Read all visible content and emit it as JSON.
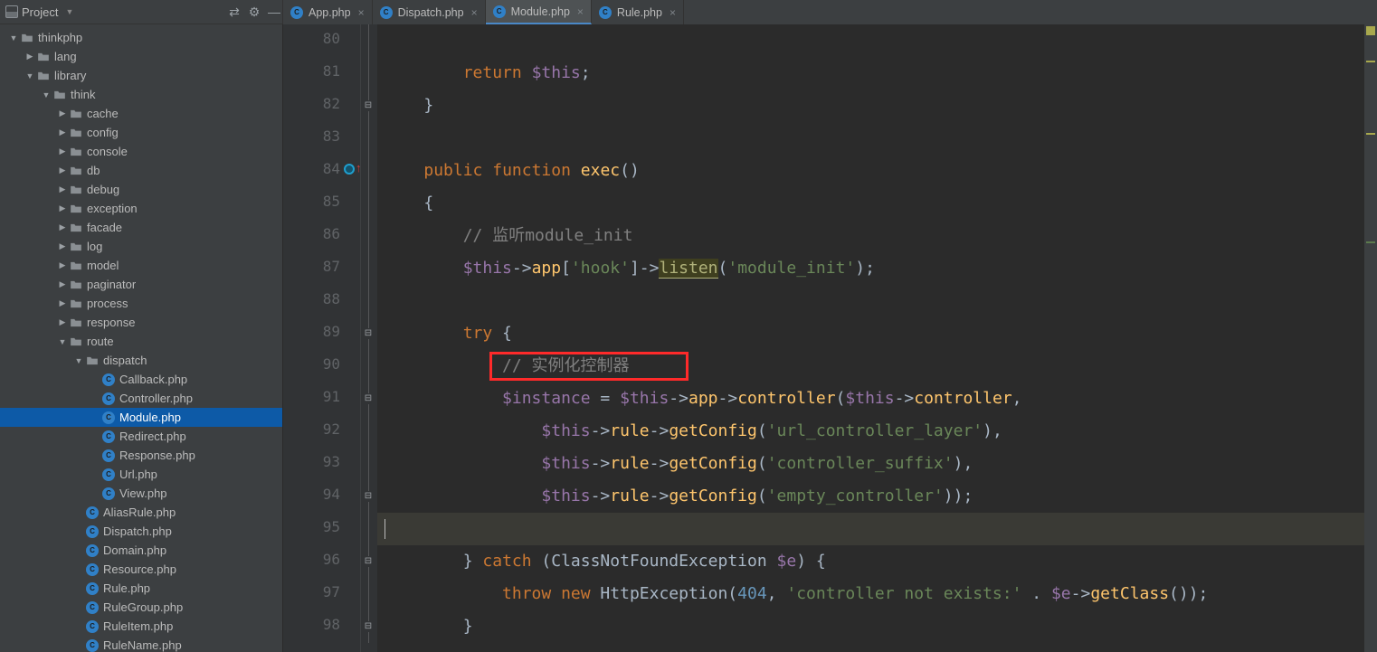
{
  "topbar": {
    "project_label": "Project",
    "settings_icon": "gear-icon",
    "hide_icon": "collapse-icon"
  },
  "tabs": [
    {
      "label": "App.php",
      "active": false
    },
    {
      "label": "Dispatch.php",
      "active": false
    },
    {
      "label": "Module.php",
      "active": true
    },
    {
      "label": "Rule.php",
      "active": false
    }
  ],
  "tree": [
    {
      "depth": 0,
      "arrow": "down",
      "kind": "folder",
      "label": "thinkphp"
    },
    {
      "depth": 1,
      "arrow": "right",
      "kind": "folder",
      "label": "lang"
    },
    {
      "depth": 1,
      "arrow": "down",
      "kind": "folder",
      "label": "library"
    },
    {
      "depth": 2,
      "arrow": "down",
      "kind": "folder",
      "label": "think"
    },
    {
      "depth": 3,
      "arrow": "right",
      "kind": "folder",
      "label": "cache"
    },
    {
      "depth": 3,
      "arrow": "right",
      "kind": "folder",
      "label": "config"
    },
    {
      "depth": 3,
      "arrow": "right",
      "kind": "folder",
      "label": "console"
    },
    {
      "depth": 3,
      "arrow": "right",
      "kind": "folder",
      "label": "db"
    },
    {
      "depth": 3,
      "arrow": "right",
      "kind": "folder",
      "label": "debug"
    },
    {
      "depth": 3,
      "arrow": "right",
      "kind": "folder",
      "label": "exception"
    },
    {
      "depth": 3,
      "arrow": "right",
      "kind": "folder",
      "label": "facade"
    },
    {
      "depth": 3,
      "arrow": "right",
      "kind": "folder",
      "label": "log"
    },
    {
      "depth": 3,
      "arrow": "right",
      "kind": "folder",
      "label": "model"
    },
    {
      "depth": 3,
      "arrow": "right",
      "kind": "folder",
      "label": "paginator"
    },
    {
      "depth": 3,
      "arrow": "right",
      "kind": "folder",
      "label": "process"
    },
    {
      "depth": 3,
      "arrow": "right",
      "kind": "folder",
      "label": "response"
    },
    {
      "depth": 3,
      "arrow": "down",
      "kind": "folder",
      "label": "route"
    },
    {
      "depth": 4,
      "arrow": "down",
      "kind": "folder",
      "label": "dispatch"
    },
    {
      "depth": 5,
      "arrow": "",
      "kind": "php",
      "label": "Callback.php"
    },
    {
      "depth": 5,
      "arrow": "",
      "kind": "php",
      "label": "Controller.php"
    },
    {
      "depth": 5,
      "arrow": "",
      "kind": "php",
      "label": "Module.php",
      "selected": true
    },
    {
      "depth": 5,
      "arrow": "",
      "kind": "php",
      "label": "Redirect.php"
    },
    {
      "depth": 5,
      "arrow": "",
      "kind": "php",
      "label": "Response.php"
    },
    {
      "depth": 5,
      "arrow": "",
      "kind": "php",
      "label": "Url.php"
    },
    {
      "depth": 5,
      "arrow": "",
      "kind": "php",
      "label": "View.php"
    },
    {
      "depth": 4,
      "arrow": "",
      "kind": "php",
      "label": "AliasRule.php"
    },
    {
      "depth": 4,
      "arrow": "",
      "kind": "php",
      "label": "Dispatch.php"
    },
    {
      "depth": 4,
      "arrow": "",
      "kind": "php",
      "label": "Domain.php"
    },
    {
      "depth": 4,
      "arrow": "",
      "kind": "php",
      "label": "Resource.php"
    },
    {
      "depth": 4,
      "arrow": "",
      "kind": "php",
      "label": "Rule.php"
    },
    {
      "depth": 4,
      "arrow": "",
      "kind": "php",
      "label": "RuleGroup.php"
    },
    {
      "depth": 4,
      "arrow": "",
      "kind": "php",
      "label": "RuleItem.php"
    },
    {
      "depth": 4,
      "arrow": "",
      "kind": "php",
      "label": "RuleName.php"
    }
  ],
  "editor": {
    "line_start": 80,
    "line_height": 36,
    "current_line": 95,
    "override_marker_line": 84,
    "fold_minus_lines": [
      82,
      89,
      91,
      94,
      96,
      98
    ],
    "lines": [
      {
        "n": 80,
        "tokens": []
      },
      {
        "n": 81,
        "tokens": [
          {
            "t": "pad",
            "v": "        "
          },
          {
            "t": "kw",
            "v": "return"
          },
          {
            "t": "punct",
            "v": " "
          },
          {
            "t": "var",
            "v": "$this"
          },
          {
            "t": "punct",
            "v": ";"
          }
        ]
      },
      {
        "n": 82,
        "tokens": [
          {
            "t": "pad",
            "v": "    "
          },
          {
            "t": "punct",
            "v": "}"
          }
        ]
      },
      {
        "n": 83,
        "tokens": []
      },
      {
        "n": 84,
        "tokens": [
          {
            "t": "pad",
            "v": "    "
          },
          {
            "t": "kw",
            "v": "public"
          },
          {
            "t": "punct",
            "v": " "
          },
          {
            "t": "kw",
            "v": "function"
          },
          {
            "t": "punct",
            "v": " "
          },
          {
            "t": "fnDef",
            "v": "exec"
          },
          {
            "t": "punct",
            "v": "()"
          }
        ]
      },
      {
        "n": 85,
        "tokens": [
          {
            "t": "pad",
            "v": "    "
          },
          {
            "t": "punct",
            "v": "{"
          }
        ]
      },
      {
        "n": 86,
        "tokens": [
          {
            "t": "pad",
            "v": "        "
          },
          {
            "t": "cmt",
            "v": "// 监听module_init"
          }
        ]
      },
      {
        "n": 87,
        "tokens": [
          {
            "t": "pad",
            "v": "        "
          },
          {
            "t": "var",
            "v": "$this"
          },
          {
            "t": "punct",
            "v": "->"
          },
          {
            "t": "fn",
            "v": "app"
          },
          {
            "t": "punct",
            "v": "["
          },
          {
            "t": "str",
            "v": "'hook'"
          },
          {
            "t": "punct",
            "v": "]->"
          },
          {
            "t": "hl",
            "v": "listen"
          },
          {
            "t": "punct",
            "v": "("
          },
          {
            "t": "str",
            "v": "'module_init'"
          },
          {
            "t": "punct",
            "v": ");"
          }
        ]
      },
      {
        "n": 88,
        "tokens": []
      },
      {
        "n": 89,
        "tokens": [
          {
            "t": "pad",
            "v": "        "
          },
          {
            "t": "kw",
            "v": "try"
          },
          {
            "t": "punct",
            "v": " {"
          }
        ]
      },
      {
        "n": 90,
        "tokens": [
          {
            "t": "pad",
            "v": "            "
          },
          {
            "t": "cmt",
            "v": "// 实例化控制器"
          }
        ]
      },
      {
        "n": 91,
        "tokens": [
          {
            "t": "pad",
            "v": "            "
          },
          {
            "t": "var",
            "v": "$instance"
          },
          {
            "t": "punct",
            "v": " = "
          },
          {
            "t": "var",
            "v": "$this"
          },
          {
            "t": "punct",
            "v": "->"
          },
          {
            "t": "fn",
            "v": "app"
          },
          {
            "t": "punct",
            "v": "->"
          },
          {
            "t": "fn",
            "v": "controller"
          },
          {
            "t": "punct",
            "v": "("
          },
          {
            "t": "var",
            "v": "$this"
          },
          {
            "t": "punct",
            "v": "->"
          },
          {
            "t": "fn",
            "v": "controller"
          },
          {
            "t": "punct",
            "v": ","
          }
        ]
      },
      {
        "n": 92,
        "tokens": [
          {
            "t": "pad",
            "v": "                "
          },
          {
            "t": "var",
            "v": "$this"
          },
          {
            "t": "punct",
            "v": "->"
          },
          {
            "t": "fn",
            "v": "rule"
          },
          {
            "t": "punct",
            "v": "->"
          },
          {
            "t": "fn",
            "v": "getConfig"
          },
          {
            "t": "punct",
            "v": "("
          },
          {
            "t": "str",
            "v": "'url_controller_layer'"
          },
          {
            "t": "punct",
            "v": "),"
          }
        ]
      },
      {
        "n": 93,
        "tokens": [
          {
            "t": "pad",
            "v": "                "
          },
          {
            "t": "var",
            "v": "$this"
          },
          {
            "t": "punct",
            "v": "->"
          },
          {
            "t": "fn",
            "v": "rule"
          },
          {
            "t": "punct",
            "v": "->"
          },
          {
            "t": "fn",
            "v": "getConfig"
          },
          {
            "t": "punct",
            "v": "("
          },
          {
            "t": "str",
            "v": "'controller_suffix'"
          },
          {
            "t": "punct",
            "v": "),"
          }
        ]
      },
      {
        "n": 94,
        "tokens": [
          {
            "t": "pad",
            "v": "                "
          },
          {
            "t": "var",
            "v": "$this"
          },
          {
            "t": "punct",
            "v": "->"
          },
          {
            "t": "fn",
            "v": "rule"
          },
          {
            "t": "punct",
            "v": "->"
          },
          {
            "t": "fn",
            "v": "getConfig"
          },
          {
            "t": "punct",
            "v": "("
          },
          {
            "t": "str",
            "v": "'empty_controller'"
          },
          {
            "t": "punct",
            "v": "));"
          }
        ]
      },
      {
        "n": 95,
        "tokens": []
      },
      {
        "n": 96,
        "tokens": [
          {
            "t": "pad",
            "v": "        "
          },
          {
            "t": "punct",
            "v": "} "
          },
          {
            "t": "kw",
            "v": "catch"
          },
          {
            "t": "punct",
            "v": " (ClassNotFoundException "
          },
          {
            "t": "var",
            "v": "$e"
          },
          {
            "t": "punct",
            "v": ") {"
          }
        ]
      },
      {
        "n": 97,
        "tokens": [
          {
            "t": "pad",
            "v": "            "
          },
          {
            "t": "kw",
            "v": "throw"
          },
          {
            "t": "punct",
            "v": " "
          },
          {
            "t": "kw",
            "v": "new"
          },
          {
            "t": "punct",
            "v": " HttpException("
          },
          {
            "t": "num",
            "v": "404"
          },
          {
            "t": "punct",
            "v": ", "
          },
          {
            "t": "str",
            "v": "'controller not exists:'"
          },
          {
            "t": "punct",
            "v": " . "
          },
          {
            "t": "var",
            "v": "$e"
          },
          {
            "t": "punct",
            "v": "->"
          },
          {
            "t": "fn",
            "v": "getClass"
          },
          {
            "t": "punct",
            "v": "());"
          }
        ]
      },
      {
        "n": 98,
        "tokens": [
          {
            "t": "pad",
            "v": "        "
          },
          {
            "t": "punct",
            "v": "}"
          }
        ]
      }
    ],
    "highlight_box_line": 90
  }
}
